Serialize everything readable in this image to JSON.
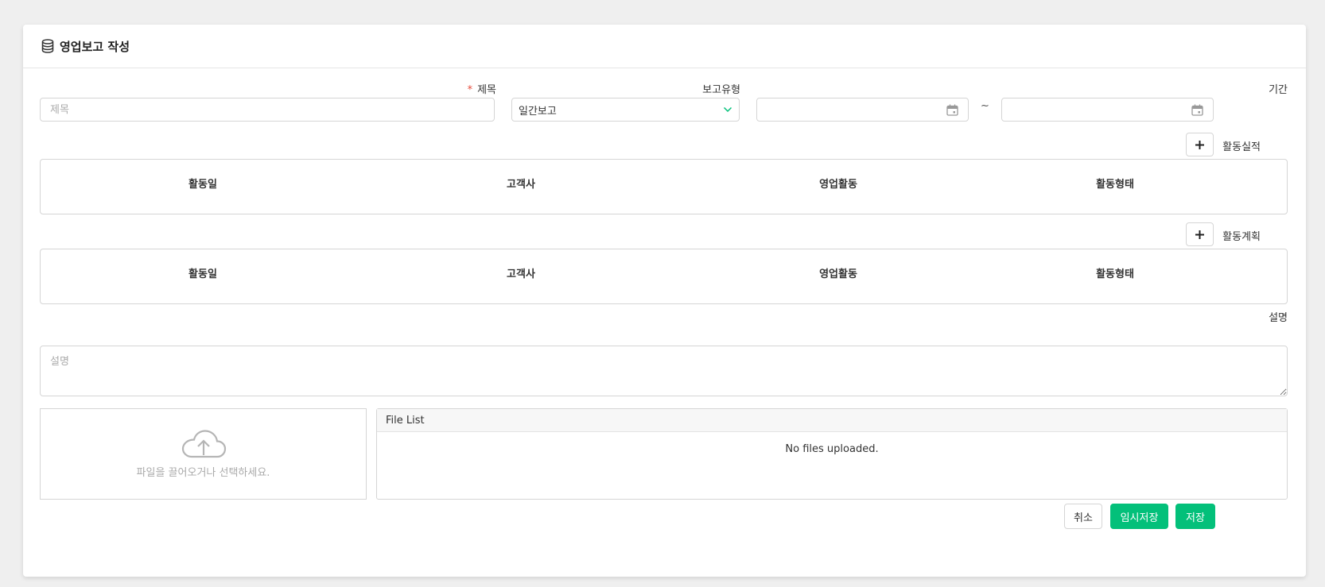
{
  "header": {
    "title": "영업보고 작성",
    "icon": "database-icon"
  },
  "form": {
    "title": {
      "label": "제목",
      "required_mark": "*",
      "placeholder": "제목",
      "value": ""
    },
    "report_type": {
      "label": "보고유형",
      "selected": "일간보고"
    },
    "period": {
      "label": "기간",
      "start": "",
      "end": "",
      "separator": "~"
    }
  },
  "activity_results": {
    "label": "활동실적",
    "columns": [
      "활동일",
      "고객사",
      "영업활동",
      "활동형태"
    ],
    "rows": []
  },
  "activity_plans": {
    "label": "활동계획",
    "columns": [
      "활동일",
      "고객사",
      "영업활동",
      "활동형태"
    ],
    "rows": []
  },
  "description": {
    "label": "설명",
    "placeholder": "설명",
    "value": ""
  },
  "upload": {
    "dropzone_text": "파일을 끌어오거나 선택하세요.",
    "file_list_title": "File List",
    "empty_text": "No files uploaded."
  },
  "actions": {
    "cancel": "취소",
    "temp_save": "임시저장",
    "save": "저장"
  },
  "colors": {
    "primary": "#03c07a",
    "required": "#e74c3c",
    "border": "#d5d5d5"
  }
}
